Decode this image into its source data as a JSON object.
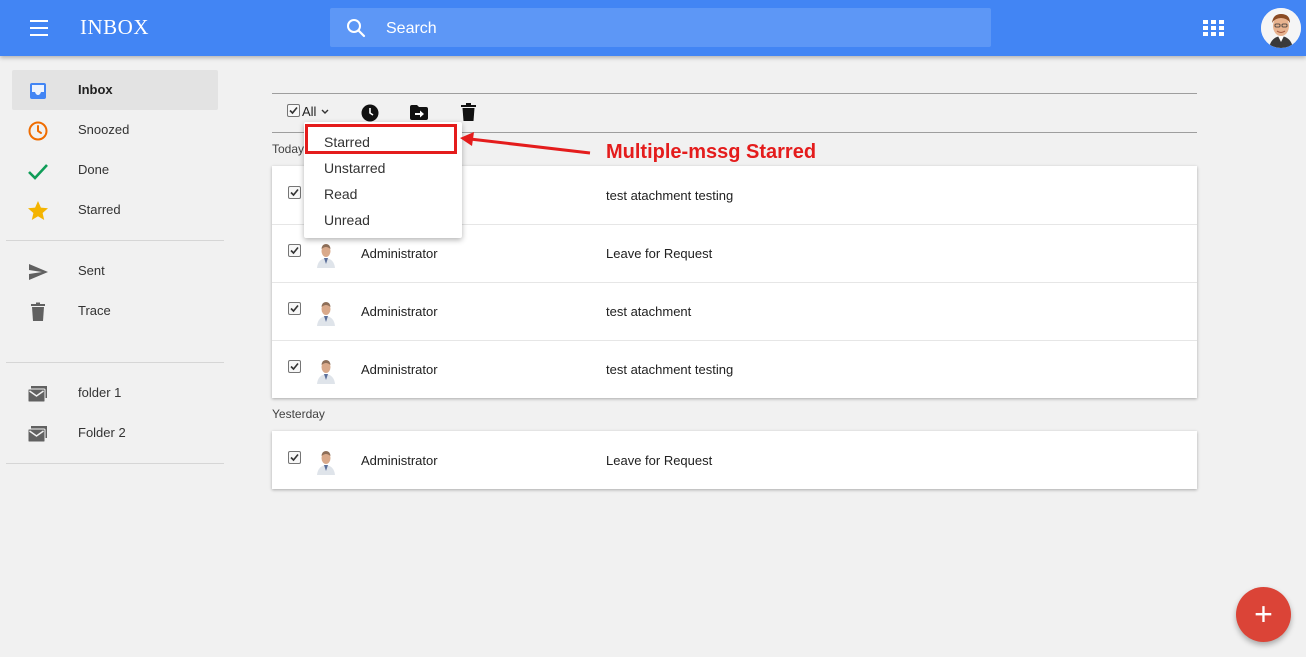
{
  "header": {
    "title": "INBOX",
    "search_placeholder": "Search"
  },
  "sidebar": {
    "items": [
      {
        "label": "Inbox",
        "icon": "inbox-icon",
        "active": true
      },
      {
        "label": "Snoozed",
        "icon": "clock-icon"
      },
      {
        "label": "Done",
        "icon": "check-icon"
      },
      {
        "label": "Starred",
        "icon": "star-icon"
      },
      {
        "label": "Sent",
        "icon": "send-icon"
      },
      {
        "label": "Trace",
        "icon": "trash-icon"
      },
      {
        "label": "folder 1",
        "icon": "mail-folder-icon"
      },
      {
        "label": "Folder 2",
        "icon": "mail-folder-icon"
      }
    ]
  },
  "toolbar": {
    "select_label": "All"
  },
  "dropdown": {
    "items": [
      "Starred",
      "Unstarred",
      "Read",
      "Unread"
    ]
  },
  "annotation": {
    "text": "Multiple-mssg Starred",
    "color": "#e41c1c"
  },
  "sections": [
    {
      "label": "Today",
      "rows": [
        {
          "sender": "",
          "subject": "test atachment testing",
          "checked": true
        },
        {
          "sender": "Administrator",
          "subject": "Leave for Request",
          "checked": true
        },
        {
          "sender": "Administrator",
          "subject": "test atachment",
          "checked": true
        },
        {
          "sender": "Administrator",
          "subject": "test atachment testing",
          "checked": true
        }
      ]
    },
    {
      "label": "Yesterday",
      "rows": [
        {
          "sender": "Administrator",
          "subject": "Leave for Request",
          "checked": true
        }
      ]
    }
  ],
  "fab": {
    "label": "+"
  },
  "colors": {
    "topbar": "#4285f4",
    "search_bg": "#5d97f6",
    "inbox_icon": "#4285f4",
    "snoozed_icon": "#ef6c00",
    "done_icon": "#0f9d58",
    "starred_icon": "#f4b400",
    "fab": "#db4437"
  }
}
